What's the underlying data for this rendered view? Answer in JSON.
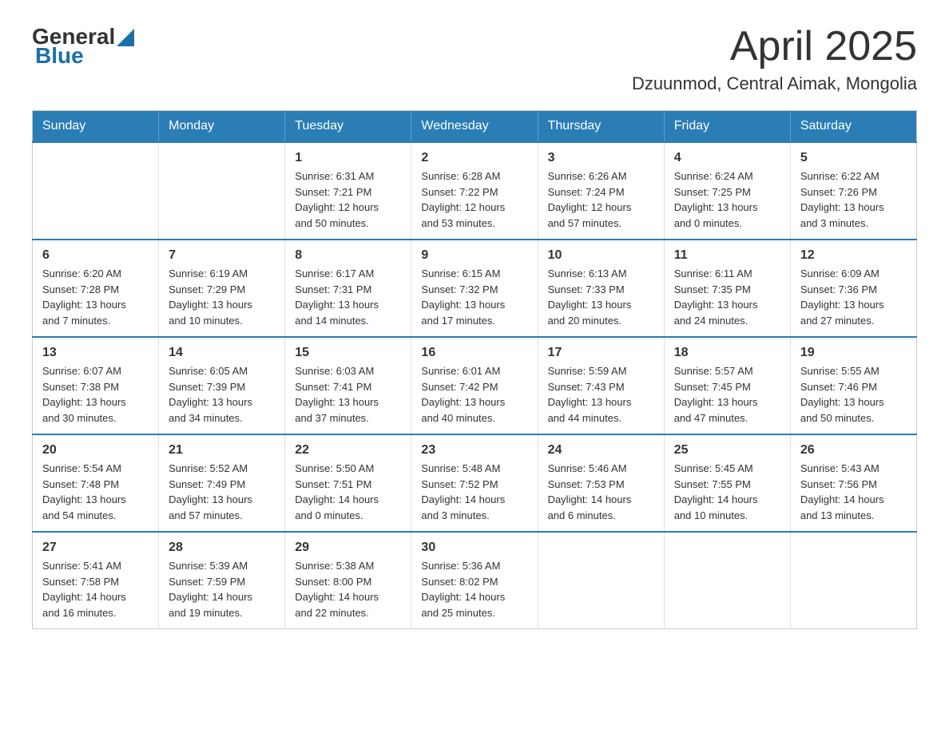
{
  "header": {
    "logo": {
      "general": "General",
      "blue": "Blue",
      "tagline": "GeneralBlue"
    },
    "title": "April 2025",
    "location": "Dzuunmod, Central Aimak, Mongolia"
  },
  "calendar": {
    "days_of_week": [
      "Sunday",
      "Monday",
      "Tuesday",
      "Wednesday",
      "Thursday",
      "Friday",
      "Saturday"
    ],
    "weeks": [
      [
        {
          "day": "",
          "info": ""
        },
        {
          "day": "",
          "info": ""
        },
        {
          "day": "1",
          "info": "Sunrise: 6:31 AM\nSunset: 7:21 PM\nDaylight: 12 hours\nand 50 minutes."
        },
        {
          "day": "2",
          "info": "Sunrise: 6:28 AM\nSunset: 7:22 PM\nDaylight: 12 hours\nand 53 minutes."
        },
        {
          "day": "3",
          "info": "Sunrise: 6:26 AM\nSunset: 7:24 PM\nDaylight: 12 hours\nand 57 minutes."
        },
        {
          "day": "4",
          "info": "Sunrise: 6:24 AM\nSunset: 7:25 PM\nDaylight: 13 hours\nand 0 minutes."
        },
        {
          "day": "5",
          "info": "Sunrise: 6:22 AM\nSunset: 7:26 PM\nDaylight: 13 hours\nand 3 minutes."
        }
      ],
      [
        {
          "day": "6",
          "info": "Sunrise: 6:20 AM\nSunset: 7:28 PM\nDaylight: 13 hours\nand 7 minutes."
        },
        {
          "day": "7",
          "info": "Sunrise: 6:19 AM\nSunset: 7:29 PM\nDaylight: 13 hours\nand 10 minutes."
        },
        {
          "day": "8",
          "info": "Sunrise: 6:17 AM\nSunset: 7:31 PM\nDaylight: 13 hours\nand 14 minutes."
        },
        {
          "day": "9",
          "info": "Sunrise: 6:15 AM\nSunset: 7:32 PM\nDaylight: 13 hours\nand 17 minutes."
        },
        {
          "day": "10",
          "info": "Sunrise: 6:13 AM\nSunset: 7:33 PM\nDaylight: 13 hours\nand 20 minutes."
        },
        {
          "day": "11",
          "info": "Sunrise: 6:11 AM\nSunset: 7:35 PM\nDaylight: 13 hours\nand 24 minutes."
        },
        {
          "day": "12",
          "info": "Sunrise: 6:09 AM\nSunset: 7:36 PM\nDaylight: 13 hours\nand 27 minutes."
        }
      ],
      [
        {
          "day": "13",
          "info": "Sunrise: 6:07 AM\nSunset: 7:38 PM\nDaylight: 13 hours\nand 30 minutes."
        },
        {
          "day": "14",
          "info": "Sunrise: 6:05 AM\nSunset: 7:39 PM\nDaylight: 13 hours\nand 34 minutes."
        },
        {
          "day": "15",
          "info": "Sunrise: 6:03 AM\nSunset: 7:41 PM\nDaylight: 13 hours\nand 37 minutes."
        },
        {
          "day": "16",
          "info": "Sunrise: 6:01 AM\nSunset: 7:42 PM\nDaylight: 13 hours\nand 40 minutes."
        },
        {
          "day": "17",
          "info": "Sunrise: 5:59 AM\nSunset: 7:43 PM\nDaylight: 13 hours\nand 44 minutes."
        },
        {
          "day": "18",
          "info": "Sunrise: 5:57 AM\nSunset: 7:45 PM\nDaylight: 13 hours\nand 47 minutes."
        },
        {
          "day": "19",
          "info": "Sunrise: 5:55 AM\nSunset: 7:46 PM\nDaylight: 13 hours\nand 50 minutes."
        }
      ],
      [
        {
          "day": "20",
          "info": "Sunrise: 5:54 AM\nSunset: 7:48 PM\nDaylight: 13 hours\nand 54 minutes."
        },
        {
          "day": "21",
          "info": "Sunrise: 5:52 AM\nSunset: 7:49 PM\nDaylight: 13 hours\nand 57 minutes."
        },
        {
          "day": "22",
          "info": "Sunrise: 5:50 AM\nSunset: 7:51 PM\nDaylight: 14 hours\nand 0 minutes."
        },
        {
          "day": "23",
          "info": "Sunrise: 5:48 AM\nSunset: 7:52 PM\nDaylight: 14 hours\nand 3 minutes."
        },
        {
          "day": "24",
          "info": "Sunrise: 5:46 AM\nSunset: 7:53 PM\nDaylight: 14 hours\nand 6 minutes."
        },
        {
          "day": "25",
          "info": "Sunrise: 5:45 AM\nSunset: 7:55 PM\nDaylight: 14 hours\nand 10 minutes."
        },
        {
          "day": "26",
          "info": "Sunrise: 5:43 AM\nSunset: 7:56 PM\nDaylight: 14 hours\nand 13 minutes."
        }
      ],
      [
        {
          "day": "27",
          "info": "Sunrise: 5:41 AM\nSunset: 7:58 PM\nDaylight: 14 hours\nand 16 minutes."
        },
        {
          "day": "28",
          "info": "Sunrise: 5:39 AM\nSunset: 7:59 PM\nDaylight: 14 hours\nand 19 minutes."
        },
        {
          "day": "29",
          "info": "Sunrise: 5:38 AM\nSunset: 8:00 PM\nDaylight: 14 hours\nand 22 minutes."
        },
        {
          "day": "30",
          "info": "Sunrise: 5:36 AM\nSunset: 8:02 PM\nDaylight: 14 hours\nand 25 minutes."
        },
        {
          "day": "",
          "info": ""
        },
        {
          "day": "",
          "info": ""
        },
        {
          "day": "",
          "info": ""
        }
      ]
    ]
  }
}
